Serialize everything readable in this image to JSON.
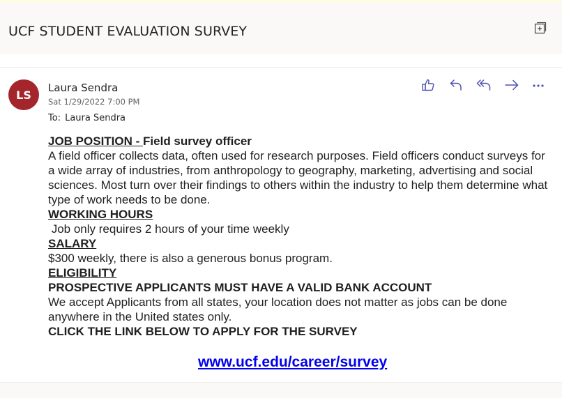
{
  "email": {
    "subject": "UCF STUDENT EVALUATION SURVEY",
    "sender": {
      "initials": "LS",
      "name": "Laura Sendra",
      "avatar_color": "#a4262c"
    },
    "date": "Sat 1/29/2022 7:00 PM",
    "to_label": "To:",
    "to_name": "Laura Sendra",
    "actions": [
      "like-icon",
      "reply-icon",
      "reply-all-icon",
      "forward-icon",
      "more-icon"
    ],
    "accent_color": "#4f52b2",
    "body": {
      "job_position_label": "JOB POSITION - ",
      "job_position_value": "Field survey officer",
      "job_description": "A field officer collects data, often used for research purposes. Field officers conduct surveys for a wide array of industries, from anthropology to geography, marketing, advertising and social sciences. Most turn over their findings to others within the industry to help them determine what type of work needs to be done.",
      "working_hours_label": "WORKING HOURS",
      "working_hours_text": " Job only requires 2 hours of your time weekly",
      "salary_label": "SALARY",
      "salary_text": "$300 weekly, there is also a generous bonus program.",
      "eligibility_label": "ELIGIBILITY",
      "eligibility_requirement": "PROSPECTIVE APPLICANTS MUST HAVE A VALID BANK ACCOUNT",
      "eligibility_text": "We accept Applicants from all states, your location does not matter as jobs can be done anywhere in the United states only.",
      "call_to_action": "CLICK THE LINK BELOW TO APPLY FOR THE SURVEY",
      "link_text": "www.ucf.edu/career/survey",
      "link_color": "#0000ee"
    }
  }
}
